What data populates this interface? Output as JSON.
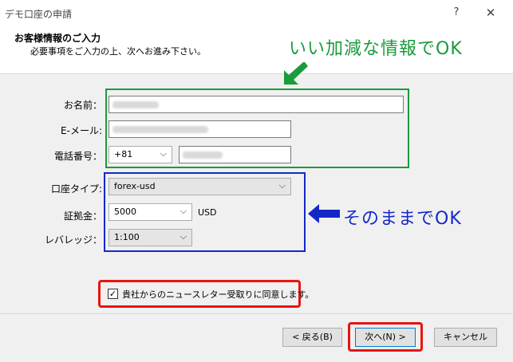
{
  "window": {
    "title": "デモ口座の申請",
    "help_glyph": "?",
    "close_glyph": "✕"
  },
  "header": {
    "title": "お客様情報のご入力",
    "subtitle": "必要事項をご入力の上、次へお進み下さい。"
  },
  "form": {
    "name_label": "お名前：",
    "email_label": "E-メール:",
    "phone_label": "電話番号：",
    "phone_country_code": "+81",
    "account_type_label": "口座タイプ:",
    "account_type_value": "forex-usd",
    "deposit_label": "証拠金：",
    "deposit_value": "5000",
    "deposit_currency": "USD",
    "leverage_label": "レバレッジ：",
    "leverage_value": "1:100",
    "newsletter_label": "貴社からのニュースレター受取りに同意します。",
    "newsletter_checked": true,
    "newsletter_check_glyph": "✓"
  },
  "buttons": {
    "back": "< 戻る(B)",
    "next": "次へ(N) >",
    "cancel": "キャンセル"
  },
  "annotations": {
    "top_text": "いい加減な情報でOK",
    "middle_text": "そのままでOK",
    "green": "#1a9b3c",
    "blue": "#1428c8",
    "red": "#e8140f"
  },
  "chevron_glyph": "⌵"
}
